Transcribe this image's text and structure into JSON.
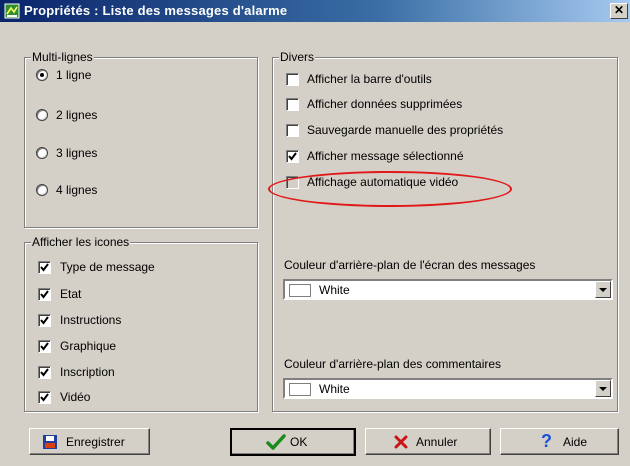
{
  "window": {
    "title": "Propriétés : Liste des messages d'alarme",
    "close_glyph": "✕",
    "app_icon": "properties-app-icon"
  },
  "multilines": {
    "legend": "Multi-lignes",
    "options": [
      {
        "label": "1 ligne",
        "selected": true
      },
      {
        "label": "2 lignes",
        "selected": false
      },
      {
        "label": "3 lignes",
        "selected": false
      },
      {
        "label": "4 lignes",
        "selected": false
      }
    ]
  },
  "icons_group": {
    "legend": "Afficher les icones",
    "items": [
      {
        "label": "Type de message",
        "checked": true
      },
      {
        "label": "Etat",
        "checked": true
      },
      {
        "label": "Instructions",
        "checked": true
      },
      {
        "label": "Graphique",
        "checked": true
      },
      {
        "label": "Inscription",
        "checked": true
      },
      {
        "label": "Vidéo",
        "checked": true
      }
    ]
  },
  "divers": {
    "legend": "Divers",
    "items": [
      {
        "label": "Afficher la barre d'outils",
        "checked": false
      },
      {
        "label": "Afficher données supprimées",
        "checked": false
      },
      {
        "label": "Sauvegarde manuelle des propriétés",
        "checked": false
      },
      {
        "label": "Afficher message sélectionné",
        "checked": true
      },
      {
        "label": "Affichage automatique vidéo",
        "checked": false,
        "highlighted": true
      }
    ],
    "highlight_color": "#e01818",
    "bg_messages_label": "Couleur d'arrière-plan de l'écran des messages",
    "bg_messages_value": "White",
    "bg_comments_label": "Couleur d'arrière-plan des commentaires",
    "bg_comments_value": "White"
  },
  "buttons": {
    "save": "Enregistrer",
    "ok": "OK",
    "cancel": "Annuler",
    "help": "Aide"
  },
  "colors": {
    "titlebar_start": "#0a246a",
    "titlebar_end": "#a6caf0",
    "face": "#d4d0c8",
    "ok_green": "#1a8a1a",
    "cancel_red": "#c81414",
    "help_blue": "#1a4fd8"
  }
}
